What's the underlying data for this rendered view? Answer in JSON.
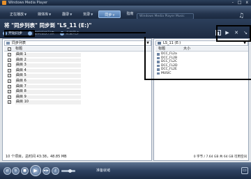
{
  "window": {
    "title": "Windows Media Player",
    "controls": "- □ x"
  },
  "nav": {
    "tabs": [
      {
        "label": "正在播放"
      },
      {
        "label": "媒体库"
      },
      {
        "label": "翻录"
      },
      {
        "label": "刻录"
      },
      {
        "label": "同步"
      },
      {
        "label": "指南"
      }
    ],
    "active_tab": "同步",
    "search_placeholder": "Windows Media Player Music",
    "logo_glyph": "♫"
  },
  "sync": {
    "heading": "将 \"同步列表\" 同步到 \"LS_11 (E:)\"",
    "toolbar": [
      {
        "label": "开始同步"
      },
      {
        "label": "编辑播放列表"
      },
      {
        "label": "设置同步"
      }
    ]
  },
  "left": {
    "playlist": "同步列表",
    "column_title": "标题",
    "rows": [
      "曲目 1",
      "曲目 2",
      "曲目 3",
      "曲目 4",
      "曲目 5",
      "曲目 6",
      "曲目 7",
      "曲目 8",
      "曲目 9",
      "曲目 10"
    ],
    "status": "10 个项目，总时间 43:38，48.85 MB"
  },
  "right": {
    "device": "LS_11 (E:)",
    "col_title": "标题",
    "col_size": "大小",
    "items": [
      "DCC_FL2a",
      "DCC_FL2B",
      "DCC_FL2C",
      "DCC_FL2D",
      "DCC_FL2E",
      "MUSIC"
    ],
    "status": "0 字节 / 7.64 GB 共 64 GB 可用空间"
  },
  "player": {
    "status": "准备就绪",
    "mini_glyph": "▭"
  }
}
